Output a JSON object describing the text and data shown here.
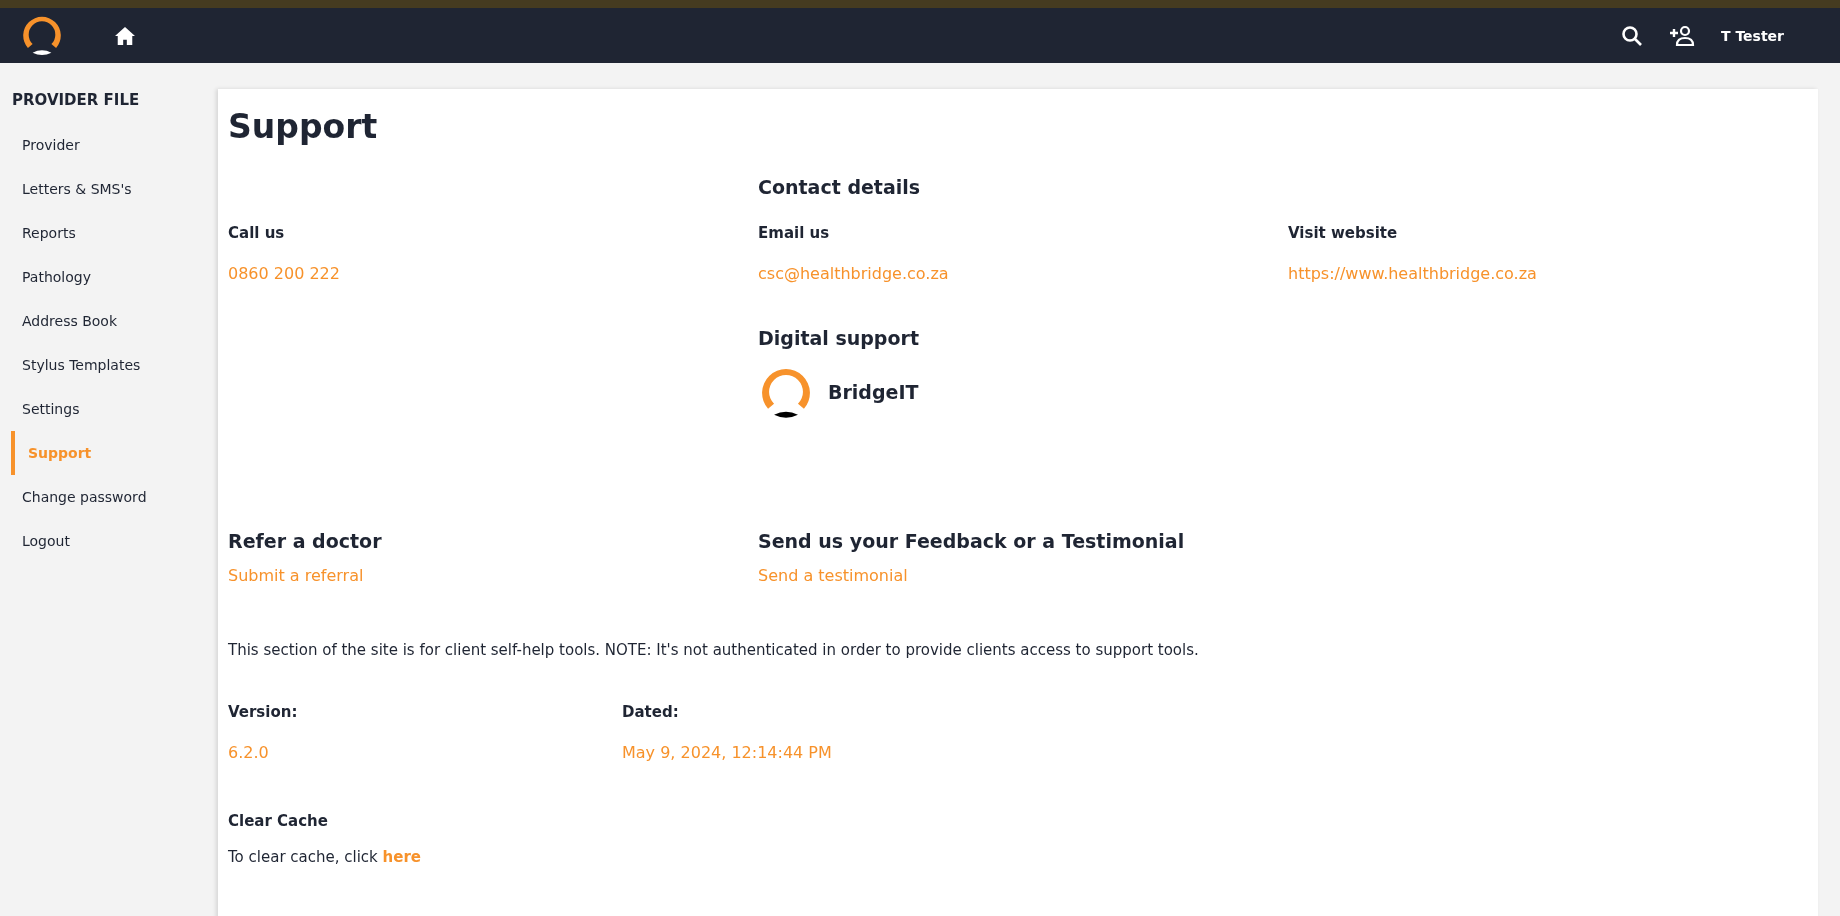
{
  "topbar": {
    "user": "T Tester"
  },
  "sidebar": {
    "heading": "PROVIDER FILE",
    "items": [
      {
        "label": "Provider",
        "selected": false
      },
      {
        "label": "Letters & SMS's",
        "selected": false
      },
      {
        "label": "Reports",
        "selected": false
      },
      {
        "label": "Pathology",
        "selected": false
      },
      {
        "label": "Address Book",
        "selected": false
      },
      {
        "label": "Stylus Templates",
        "selected": false
      },
      {
        "label": "Settings",
        "selected": false
      },
      {
        "label": "Support",
        "selected": true
      },
      {
        "label": "Change password",
        "selected": false
      },
      {
        "label": "Logout",
        "selected": false
      }
    ]
  },
  "page": {
    "title": "Support",
    "contact": {
      "heading": "Contact details",
      "items": [
        {
          "label": "Call us",
          "value": "0860 200 222"
        },
        {
          "label": "Email us",
          "value": "csc@healthbridge.co.za"
        },
        {
          "label": "Visit website",
          "value": "https://www.healthbridge.co.za"
        }
      ]
    },
    "digital": {
      "heading": "Digital support",
      "name": "BridgeIT"
    },
    "refer": {
      "heading": "Refer a doctor",
      "link": "Submit a referral"
    },
    "feedback": {
      "heading": "Send us your Feedback or a Testimonial",
      "link": "Send a testimonial"
    },
    "note": "This section of the site is for client self-help tools. NOTE: It's not authenticated in order to provide clients access to support tools.",
    "version": {
      "label": "Version:",
      "value": "6.2.0"
    },
    "dated": {
      "label": "Dated:",
      "value": "May 9, 2024, 12:14:44 PM"
    },
    "clear_cache": {
      "heading": "Clear Cache",
      "text": "To clear cache, click ",
      "link": "here"
    }
  }
}
